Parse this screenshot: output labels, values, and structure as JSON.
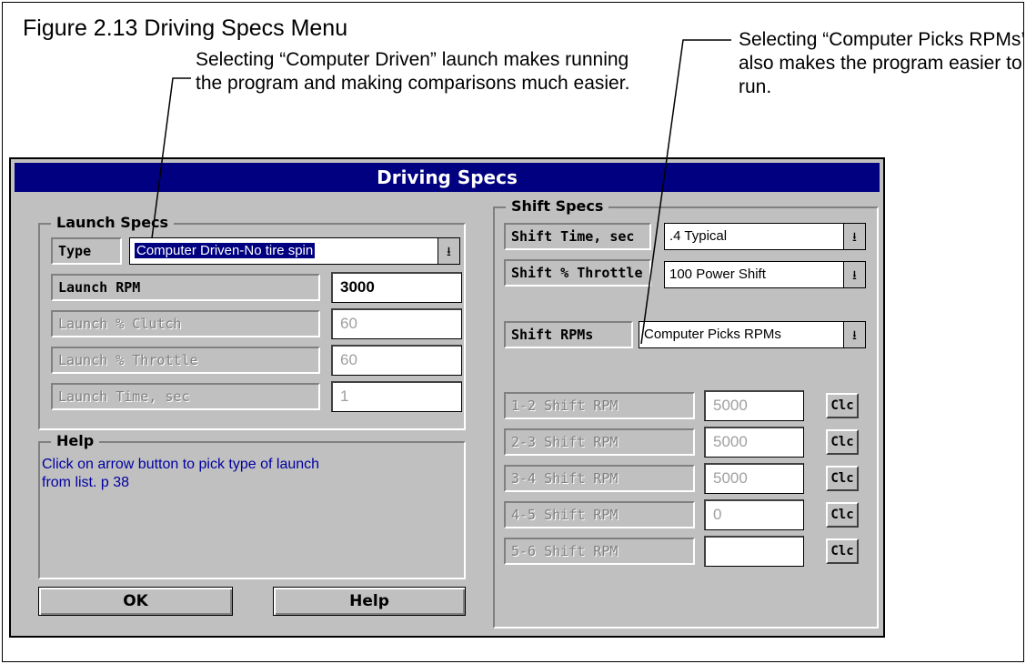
{
  "figure": {
    "title": "Figure 2.13  Driving Specs Menu",
    "caption_left": "Selecting “Computer Driven” launch makes running the program  and making comparisons much easier.",
    "caption_right": "Selecting “Computer Picks RPMs’ also makes the program easier to run."
  },
  "dialog": {
    "title": "Driving Specs",
    "launch": {
      "group_label": "Launch Specs",
      "type_label": "Type",
      "type_value": "Computer Driven-No tire spin",
      "rpm_label": "Launch RPM",
      "rpm_value": "3000",
      "clutch_label": "Launch % Clutch",
      "clutch_value": "60",
      "throttle_label": "Launch % Throttle",
      "throttle_value": "60",
      "time_label": "Launch Time, sec",
      "time_value": "1"
    },
    "help": {
      "group_label": "Help",
      "text": "Click on arrow button to pick type of launch from list. p 38"
    },
    "buttons": {
      "ok": "OK",
      "help": "Help"
    },
    "shift": {
      "group_label": "Shift Specs",
      "time_label": "Shift Time, sec",
      "time_value": ".4 Typical",
      "throttle_label": "Shift % Throttle",
      "throttle_value": "100 Power Shift",
      "rpms_label": "Shift RPMs",
      "rpms_value": "Computer Picks RPMs",
      "clear_label": "Clc",
      "rows": [
        {
          "label": "1-2 Shift RPM",
          "value": "5000"
        },
        {
          "label": "2-3 Shift RPM",
          "value": "5000"
        },
        {
          "label": "3-4 Shift RPM",
          "value": "5000"
        },
        {
          "label": "4-5 Shift RPM",
          "value": "0"
        },
        {
          "label": "5-6 Shift RPM",
          "value": ""
        }
      ]
    }
  },
  "colors": {
    "titlebar": "#000080",
    "dialog_bg": "#c0c0c0",
    "help_text": "#0000a0"
  },
  "icons": {
    "dropdown": "down-arrow-icon"
  }
}
